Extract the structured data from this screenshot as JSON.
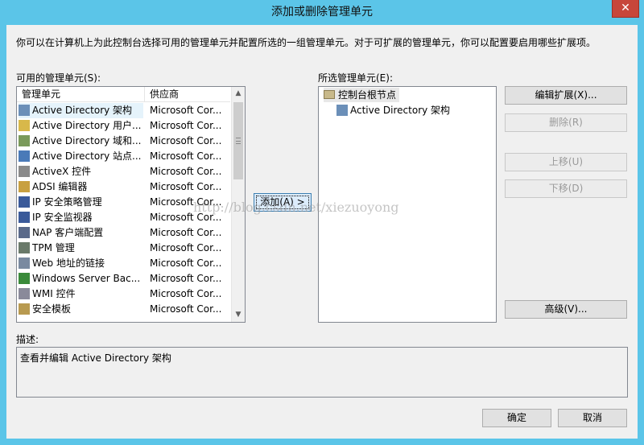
{
  "window": {
    "title": "添加或删除管理单元",
    "close_glyph": "✕"
  },
  "intro_text": "你可以在计算机上为此控制台选择可用的管理单元并配置所选的一组管理单元。对于可扩展的管理单元，你可以配置要启用哪些扩展项。",
  "available": {
    "label": "可用的管理单元(S):",
    "col_name": "管理单元",
    "col_vendor": "供应商",
    "items": [
      {
        "name": "Active Directory 架构",
        "vendor": "Microsoft Cor...",
        "icon": "schema-icon",
        "color": "#6b8fb8"
      },
      {
        "name": "Active Directory 用户...",
        "vendor": "Microsoft Cor...",
        "icon": "users-computers-icon",
        "color": "#d8b84a"
      },
      {
        "name": "Active Directory 域和...",
        "vendor": "Microsoft Cor...",
        "icon": "domains-trusts-icon",
        "color": "#7a9a5a"
      },
      {
        "name": "Active Directory 站点...",
        "vendor": "Microsoft Cor...",
        "icon": "sites-services-icon",
        "color": "#4a7ab8"
      },
      {
        "name": "ActiveX 控件",
        "vendor": "Microsoft Cor...",
        "icon": "activex-icon",
        "color": "#8a8a8a"
      },
      {
        "name": "ADSI 编辑器",
        "vendor": "Microsoft Cor...",
        "icon": "adsi-edit-icon",
        "color": "#c8a040"
      },
      {
        "name": "IP 安全策略管理",
        "vendor": "Microsoft Cor...",
        "icon": "ipsec-policy-icon",
        "color": "#3a5a9a"
      },
      {
        "name": "IP 安全监视器",
        "vendor": "Microsoft Cor...",
        "icon": "ipsec-monitor-icon",
        "color": "#3a5a9a"
      },
      {
        "name": "NAP 客户端配置",
        "vendor": "Microsoft Cor...",
        "icon": "nap-client-icon",
        "color": "#5a6a8a"
      },
      {
        "name": "TPM 管理",
        "vendor": "Microsoft Cor...",
        "icon": "tpm-icon",
        "color": "#6a7a6a"
      },
      {
        "name": "Web 地址的链接",
        "vendor": "Microsoft Cor...",
        "icon": "web-link-icon",
        "color": "#7a8aa0"
      },
      {
        "name": "Windows Server Bac...",
        "vendor": "Microsoft Cor...",
        "icon": "server-backup-icon",
        "color": "#3a8a3a"
      },
      {
        "name": "WMI 控件",
        "vendor": "Microsoft Cor...",
        "icon": "wmi-icon",
        "color": "#8a8a9a"
      },
      {
        "name": "安全模板",
        "vendor": "Microsoft Cor...",
        "icon": "security-template-icon",
        "color": "#b89a50"
      }
    ]
  },
  "add_button": "添加(A) >",
  "selected": {
    "label": "所选管理单元(E):",
    "root": "控制台根节点",
    "child": "Active Directory 架构"
  },
  "buttons": {
    "edit_extensions": "编辑扩展(X)...",
    "remove": "删除(R)",
    "move_up": "上移(U)",
    "move_down": "下移(D)",
    "advanced": "高级(V)...",
    "ok": "确定",
    "cancel": "取消"
  },
  "description": {
    "label": "描述:",
    "text": "查看并编辑 Active Directory 架构"
  },
  "watermark": "http://blog.csdn.net/xiezuoyong"
}
